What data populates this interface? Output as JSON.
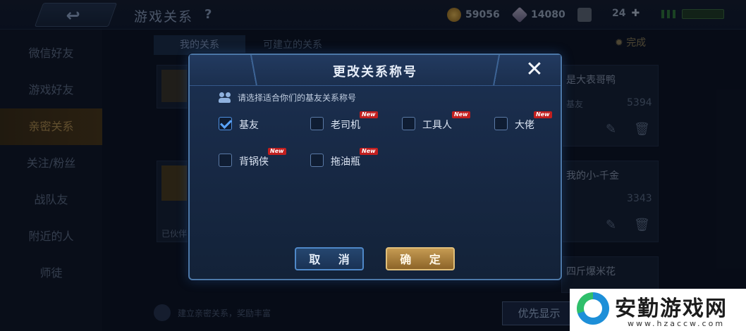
{
  "topbar": {
    "back_icon": "back-arrow-icon",
    "title": "游戏关系",
    "help": "?",
    "gold": "59056",
    "diamonds": "14080",
    "tickets": "24"
  },
  "sidebar": {
    "items": [
      {
        "label": "微信好友"
      },
      {
        "label": "游戏好友"
      },
      {
        "label": "亲密关系"
      },
      {
        "label": "关注/粉丝"
      },
      {
        "label": "战队友"
      },
      {
        "label": "附近的人"
      },
      {
        "label": "师徒"
      }
    ],
    "active_index": 2
  },
  "background": {
    "tabs": [
      "我的关系",
      "可建立的关系"
    ],
    "done_label": "完成",
    "cards": [
      {
        "name": "是大表哥鸭",
        "tag": "基友",
        "score": "5394"
      },
      {
        "name": "我的小-千金",
        "tag": "",
        "score": "3343"
      },
      {
        "name": "四斤爆米花",
        "tag": "",
        "score": ""
      }
    ],
    "left_card_text": "已伙伴",
    "footer_text": "建立亲密关系，奖励丰富",
    "priority_button": "优先显示"
  },
  "modal": {
    "title": "更改关系称号",
    "close_icon": "close-x-icon",
    "instruction": "请选择适合你们的基友关系称号",
    "options": [
      {
        "label": "基友",
        "checked": true,
        "is_new": false
      },
      {
        "label": "老司机",
        "checked": false,
        "is_new": true
      },
      {
        "label": "工具人",
        "checked": false,
        "is_new": true
      },
      {
        "label": "大佬",
        "checked": false,
        "is_new": true
      },
      {
        "label": "背锅侠",
        "checked": false,
        "is_new": true
      },
      {
        "label": "拖油瓶",
        "checked": false,
        "is_new": true
      }
    ],
    "new_badge": "New",
    "cancel_label": "取 消",
    "confirm_label": "确 定"
  },
  "watermark": {
    "name": "安勤游戏网",
    "url": "www.hzaccw.com"
  },
  "colors": {
    "accent_gold": "#c59a52",
    "accent_blue": "#4f88c8",
    "new_badge": "#c21f1f"
  }
}
